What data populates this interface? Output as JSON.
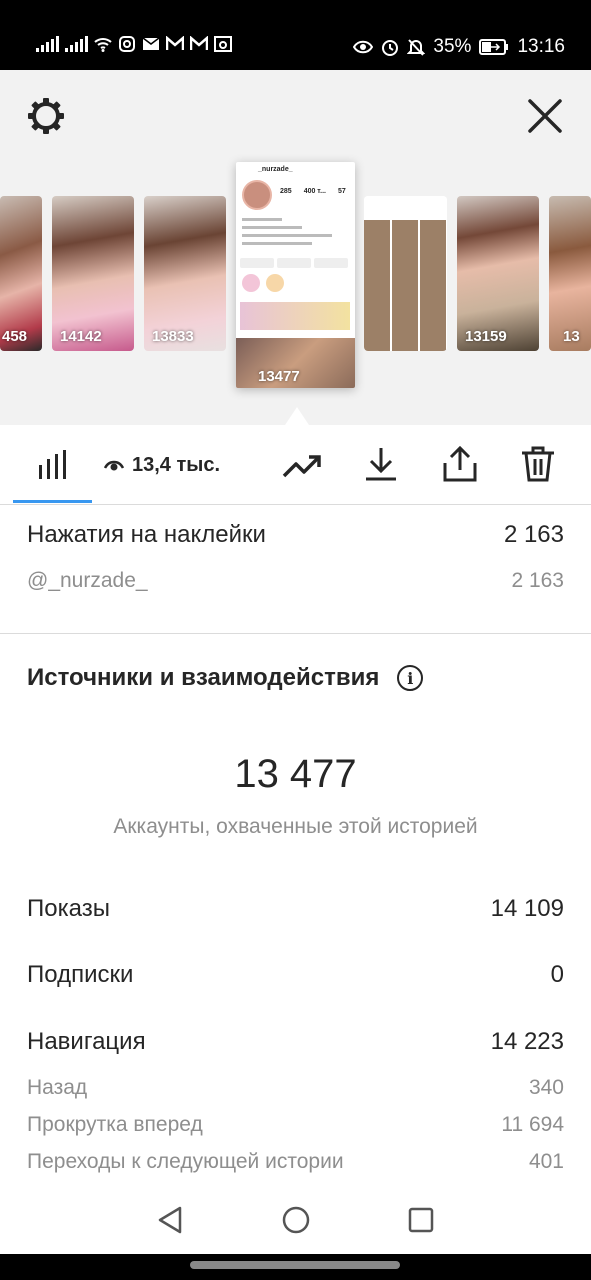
{
  "status_bar": {
    "battery": "35%",
    "time": "13:16"
  },
  "header": {
    "settings_icon": "gear-icon",
    "close_icon": "close-icon"
  },
  "stories": {
    "thumbnails": [
      {
        "count": "458"
      },
      {
        "count": "14142"
      },
      {
        "count": "13833"
      },
      {
        "count": "13477"
      },
      {
        "count": ""
      },
      {
        "count": "13159"
      },
      {
        "count": "13"
      }
    ],
    "selected": {
      "profile_name": "_nurzade_",
      "posts": "285",
      "followers": "400 т...",
      "following": "57"
    }
  },
  "tabs": {
    "insights_icon": "bar-chart-icon",
    "views_count": "13,4 тыс.",
    "promote_icon": "trend-icon",
    "download_icon": "download-icon",
    "share_icon": "share-icon",
    "delete_icon": "trash-icon"
  },
  "sticker_taps": {
    "label": "Нажатия на наклейки",
    "value": "2 163",
    "sub": {
      "label": "@_nurzade_",
      "value": "2 163"
    }
  },
  "discovery": {
    "title": "Источники и взаимодействия",
    "reach_value": "13 477",
    "reach_label": "Аккаунты, охваченные этой историей",
    "rows": [
      {
        "label": "Показы",
        "value": "14 109"
      },
      {
        "label": "Подписки",
        "value": "0"
      },
      {
        "label": "Навигация",
        "value": "14 223"
      }
    ],
    "navigation": [
      {
        "label": "Назад",
        "value": "340"
      },
      {
        "label": "Прокрутка вперед",
        "value": "11 694"
      },
      {
        "label": "Переходы к следующей истории",
        "value": "401"
      }
    ]
  },
  "navbar": {
    "back_icon": "back-triangle-icon",
    "home_icon": "home-circle-icon",
    "recents_icon": "recents-square-icon"
  }
}
